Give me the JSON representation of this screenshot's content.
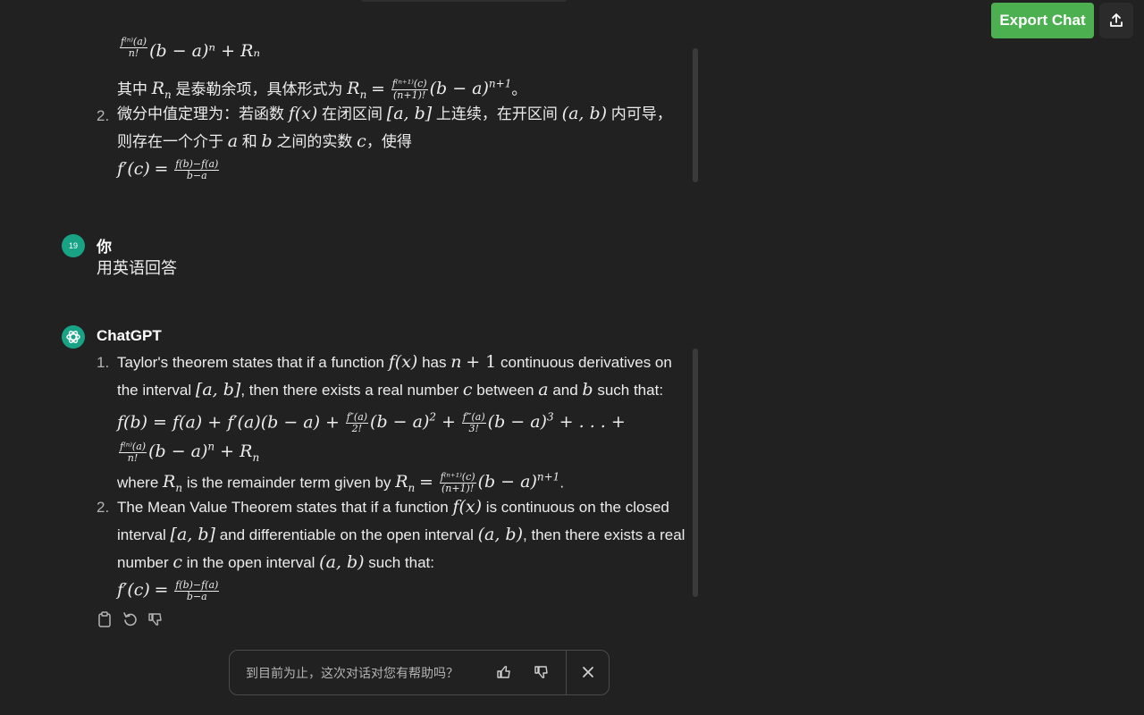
{
  "toolbar": {
    "export_label": "Export Chat",
    "share_icon": "upload-icon"
  },
  "prev_answer": {
    "line_a_tail": "(b − a)ⁿ + Rₙ",
    "line_b_prefix": "其中",
    "line_b_mid": "是泰勒余项，具体形式为",
    "line_b_end": "。",
    "item2_num": "2.",
    "item2_l1a": "微分中值定理为：若函数",
    "item2_l1b": "在闭区间",
    "item2_l1c": "上连续，在开区间",
    "item2_l1d": "内可导，",
    "item2_l2a": "则存在一个介于",
    "item2_l2b": "和",
    "item2_l2c": "之间的实数",
    "item2_l2d": "，使得"
  },
  "user_msg": {
    "avatar_label": "19",
    "speaker": "你",
    "text": "用英语回答"
  },
  "gpt_msg": {
    "speaker": "ChatGPT",
    "item1_num": "1.",
    "i1_l1a": "Taylor's theorem states that if a function",
    "i1_l1b": "has",
    "i1_l1c": "continuous derivatives on",
    "i1_l2a": "the interval",
    "i1_l2b": ", then there exists a real number",
    "i1_l2c": "between",
    "i1_l2d": "and",
    "i1_l2e": "such that:",
    "i1_l5a": "where",
    "i1_l5b": "is the remainder term given by",
    "item2_num": "2.",
    "i2_l1a": "The Mean Value Theorem states that if a function",
    "i2_l1b": "is continuous on the closed",
    "i2_l2a": "interval",
    "i2_l2b": "and differentiable on the open interval",
    "i2_l2c": ", then there exists a real",
    "i2_l3a": "number",
    "i2_l3b": "in the open interval",
    "i2_l3c": "such that:"
  },
  "actions": [
    "clipboard-icon",
    "regenerate-icon",
    "thumbs-down-icon"
  ],
  "feedback": {
    "question": "到目前为止，这次对话对您有帮助吗？"
  },
  "colors": {
    "background": "#212121",
    "accent": "#4caf50",
    "avatar": "#19a385"
  }
}
